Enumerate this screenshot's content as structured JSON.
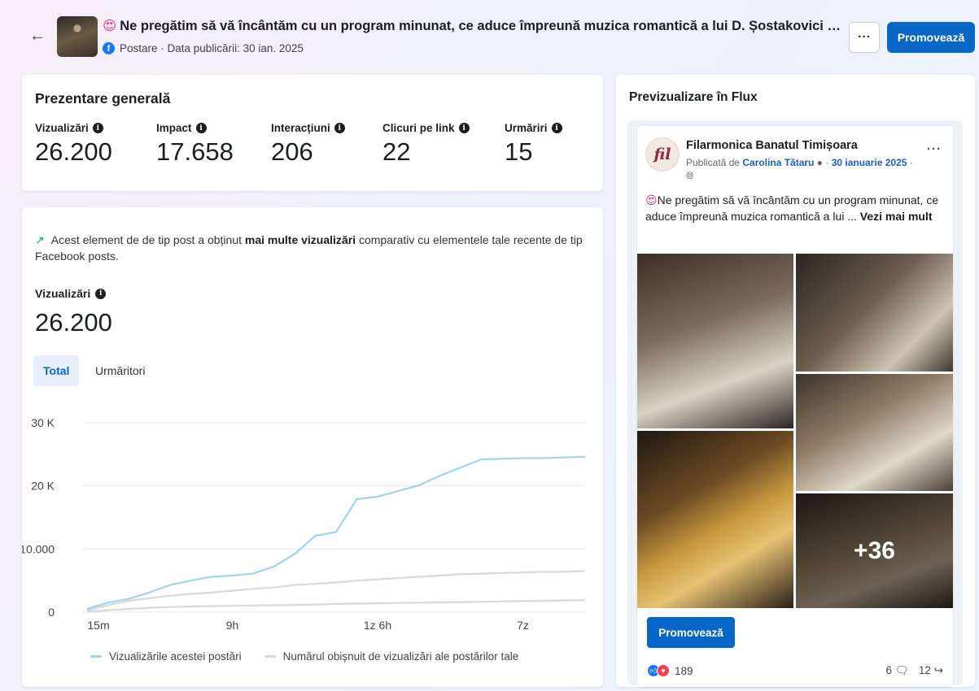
{
  "header": {
    "emoji": "😍",
    "title": "Ne pregătim să vă încântăm cu un program minunat, ce aduce împreună muzica romantică a lui D. Șostakovici și influențele...",
    "subtitle": "Postare · Data publicării: 30 ian. 2025",
    "more_label": "···",
    "promote_label": "Promovează"
  },
  "overview": {
    "title": "Prezentare generală",
    "metrics": [
      {
        "label": "Vizualizări",
        "value": "26.200"
      },
      {
        "label": "Impact",
        "value": "17.658"
      },
      {
        "label": "Interacțiuni",
        "value": "206"
      },
      {
        "label": "Clicuri pe link",
        "value": "22"
      },
      {
        "label": "Urmăriri",
        "value": "15"
      }
    ]
  },
  "views": {
    "insight_before": "Acest element de de tip post a obținut",
    "insight_bold": "mai multe vizualizări",
    "insight_after": "comparativ cu elementele tale recente de tip Facebook posts.",
    "label": "Vizualizări",
    "value": "26.200",
    "tabs": [
      "Total",
      "Urmăritori"
    ]
  },
  "chart_data": {
    "type": "line",
    "x_ticks": [
      "15m",
      "9h",
      "1z 6h",
      "7z"
    ],
    "y_ticks": [
      "0",
      "10.000",
      "20 K",
      "30 K"
    ],
    "ylim": [
      0,
      30000
    ],
    "x": [
      0,
      1,
      2,
      3,
      4,
      5,
      6,
      7,
      8,
      9,
      10,
      11,
      12,
      13,
      14,
      15,
      16,
      17,
      18,
      19,
      20,
      21,
      22,
      23,
      24
    ],
    "series": [
      {
        "name": "Vizualizările acestei postări",
        "color": "#9fd3f0",
        "values": [
          500,
          1500,
          2100,
          3100,
          4300,
          5000,
          5600,
          5800,
          6100,
          7200,
          9200,
          12100,
          12700,
          17900,
          18300,
          19200,
          20100,
          21600,
          22900,
          24200,
          24300,
          24400,
          24400,
          24500,
          24600
        ]
      },
      {
        "name": "Numărul obișnuit de vizualizări ale postărilor tale",
        "color": "#d9d9d9",
        "values": [
          300,
          1100,
          1800,
          2200,
          2600,
          2900,
          3100,
          3400,
          3700,
          3900,
          4300,
          4500,
          4700,
          5000,
          5200,
          5400,
          5600,
          5800,
          6000,
          6100,
          6200,
          6300,
          6400,
          6400,
          6500
        ]
      },
      {
        "name": "",
        "color": "#d9d9d9",
        "values": [
          100,
          300,
          500,
          700,
          800,
          900,
          950,
          1000,
          1050,
          1100,
          1150,
          1200,
          1300,
          1350,
          1400,
          1450,
          1500,
          1550,
          1600,
          1650,
          1700,
          1750,
          1800,
          1850,
          1900
        ]
      }
    ]
  },
  "legend": {
    "series_a": "Vizualizările acestei postări",
    "series_b": "Numărul obișnuit de vizualizări ale postărilor tale",
    "color_a": "#9fd3f0",
    "color_b": "#d9d9d9"
  },
  "preview": {
    "title": "Previzualizare în Flux",
    "page_name": "Filarmonica Banatul Timișoara",
    "avatar_glyph": "fil",
    "meta_prefix": "Publicată de",
    "author": "Carolina Tătaru",
    "date": "30 ianuarie 2025",
    "post_emoji": "😍",
    "post_text": "Ne pregătim să vă încântăm cu un program minunat, ce aduce împreună muzica romantică a lui ...",
    "see_more": "Vezi mai mult",
    "more_photos": "+36",
    "promote_label": "Promovează",
    "reactions_count": "189",
    "comments_count": "6",
    "shares_count": "12",
    "post_more_label": "···"
  }
}
